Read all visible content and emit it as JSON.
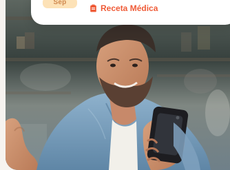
{
  "card": {
    "month": "Sep",
    "label": "Receta Médica"
  },
  "photo": {
    "subject": "man smiling while using a phone"
  },
  "colors": {
    "accent": "#ef5b37",
    "pill_background": "#fde2b7",
    "pill_text": "#d0894f",
    "card_background": "#ffffff"
  },
  "icons": {
    "badge_icon": "clipboard-icon"
  }
}
